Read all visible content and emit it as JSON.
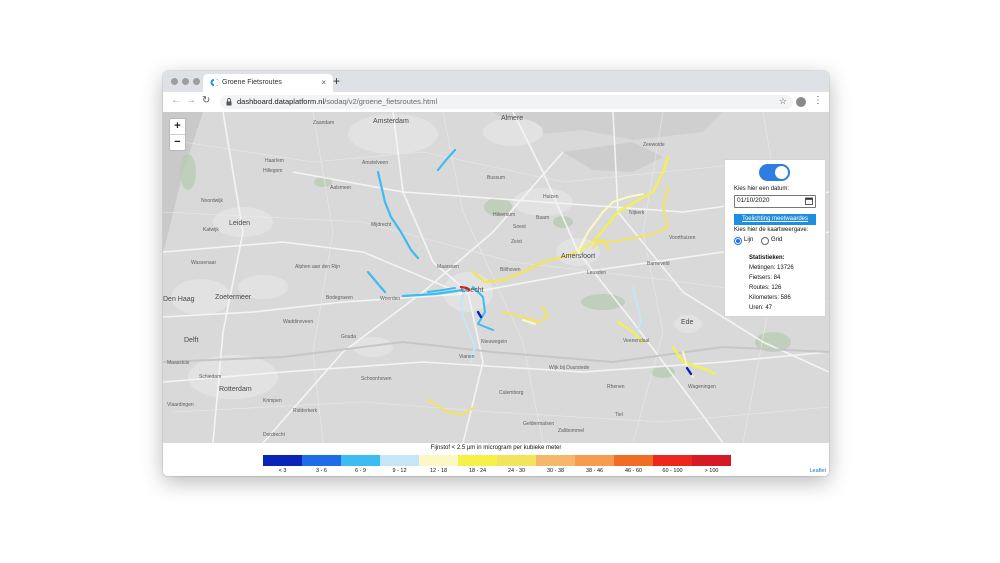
{
  "browser": {
    "tab_title": "Groene Fietsroutes",
    "new_tab": "+",
    "url_domain": "dashboard.dataplatform.nl",
    "url_path": "/sodaq/v2/groene_fietsroutes.html"
  },
  "map": {
    "zoom_in": "+",
    "zoom_out": "−",
    "cities": [
      "Amsterdam",
      "Almere",
      "Leiden",
      "Zoetermeer",
      "Delft",
      "Rotterdam",
      "Utrecht",
      "Amersfoort",
      "Ede",
      "Den Haag"
    ],
    "places": [
      "Zaandam",
      "Amstelveen",
      "Haarlem",
      "Hillegom",
      "Aalsmeer",
      "Mijdrecht",
      "Woerden",
      "Maarssen",
      "Bilthoven",
      "Zeist",
      "Soest",
      "Baarn",
      "Huizen",
      "Nijkerk",
      "Leusden",
      "Barneveld",
      "Veenendaal",
      "Culemborg",
      "Vianen",
      "Gouda",
      "Schoonhoven",
      "Alphen aan den Rijn",
      "Bodegraven",
      "Waddinxveen",
      "Nieuwegein",
      "Wijk bij Duurstede",
      "Wageningen",
      "Rhenen",
      "Zeewolde",
      "Bussum",
      "Hilversum",
      "Voorthuizen",
      "Katwijk",
      "Noordwijk",
      "Wassenaar",
      "Maassluis",
      "Vlaardingen",
      "Schiedam",
      "Krimpen",
      "Ridderkerk",
      "Dordrecht",
      "Geldermalsen",
      "Zaltbommel",
      "Tiel"
    ]
  },
  "panel": {
    "date_label": "Kies hier een datum:",
    "date_value": "01/10/2020",
    "explain_button": "Toelichting meetwaardes",
    "view_label": "Kies hier de kaartweergave:",
    "option_line": "Lijn",
    "option_grid": "Grid",
    "stats_title": "Statistieken:",
    "stats": [
      "Metingen: 13726",
      "Fietsers: 84",
      "Routes: 126",
      "Kilometers: 586",
      "Uren: 47"
    ]
  },
  "legend": {
    "title": "Fijnstof < 2.5 µm in microgram per kubieke meter",
    "classes": [
      {
        "label": "< 3",
        "color": "#0a24b8"
      },
      {
        "label": "3 - 6",
        "color": "#1e6de6"
      },
      {
        "label": "6 - 9",
        "color": "#3cbcf0"
      },
      {
        "label": "9 - 12",
        "color": "#c3e7f7"
      },
      {
        "label": "12 - 18",
        "color": "#fbf8c4"
      },
      {
        "label": "18 - 24",
        "color": "#f4f14a"
      },
      {
        "label": "24 - 30",
        "color": "#f3e45c"
      },
      {
        "label": "30 - 38",
        "color": "#f5b76c"
      },
      {
        "label": "38 - 46",
        "color": "#f69c4d"
      },
      {
        "label": "46 - 60",
        "color": "#f16d24"
      },
      {
        "label": "60 - 100",
        "color": "#e9271d"
      },
      {
        "label": "> 100",
        "color": "#d61a25"
      }
    ],
    "attribution": "Leaflet"
  }
}
